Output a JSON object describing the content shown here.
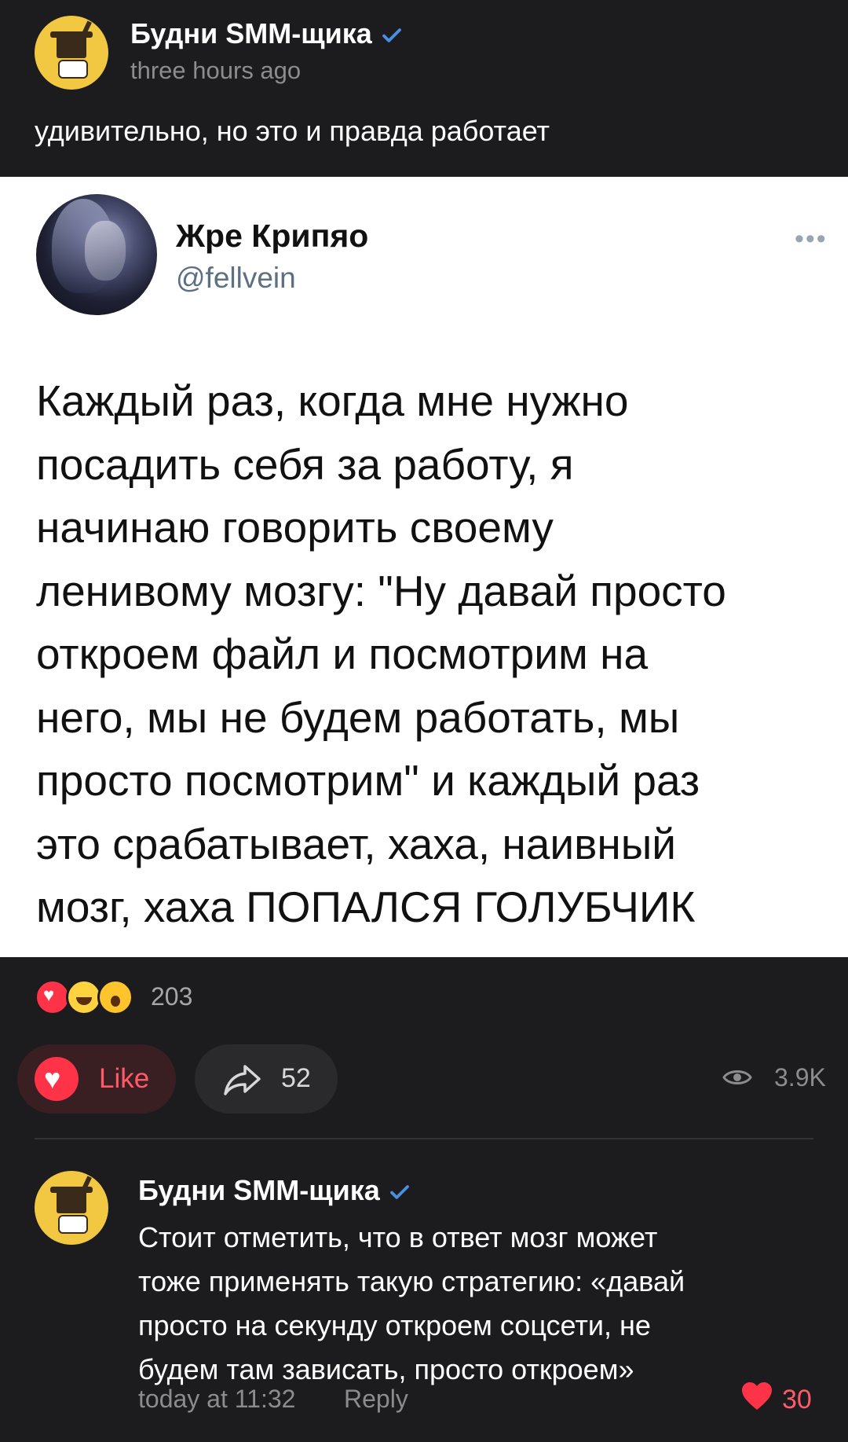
{
  "post": {
    "author": "Будни SMM-щика",
    "time": "three hours ago",
    "text": "удивительно, но это и правда работает"
  },
  "tweet": {
    "name": "Жре Крипяо",
    "handle": "@fellvein",
    "more": "•••",
    "lines": [
      "Каждый раз, когда мне нужно",
      "посадить себя за работу, я",
      "начинаю говорить своему",
      "ленивому мозгу: \"Ну давай просто",
      "откроем файл и посмотрим на",
      "него, мы не будем работать, мы",
      "просто посмотрим\" и каждый раз",
      "это срабатывает, хаха, наивный",
      "мозг, хаха ПОПАЛСЯ ГОЛУБЧИК"
    ]
  },
  "reactions": {
    "icons": [
      "heart-reaction-icon",
      "laughing-tears-reaction-icon",
      "surprised-reaction-icon"
    ],
    "count": "203"
  },
  "actions": {
    "like_label": "Like",
    "share_count": "52",
    "views": "3.9K"
  },
  "comment": {
    "author": "Будни SMM-щика",
    "lines": [
      "Стоит отметить, что в ответ мозг может",
      "тоже применять такую стратегию: «давай",
      "просто на секунду откроем соцсети, не",
      "будем там зависать, просто откроем»"
    ],
    "time": "today at 11:32",
    "reply_label": "Reply",
    "likes": "30"
  },
  "colors": {
    "background": "#1c1c1e",
    "accent_red": "#ff3347",
    "verified_blue": "#4a90e2"
  }
}
